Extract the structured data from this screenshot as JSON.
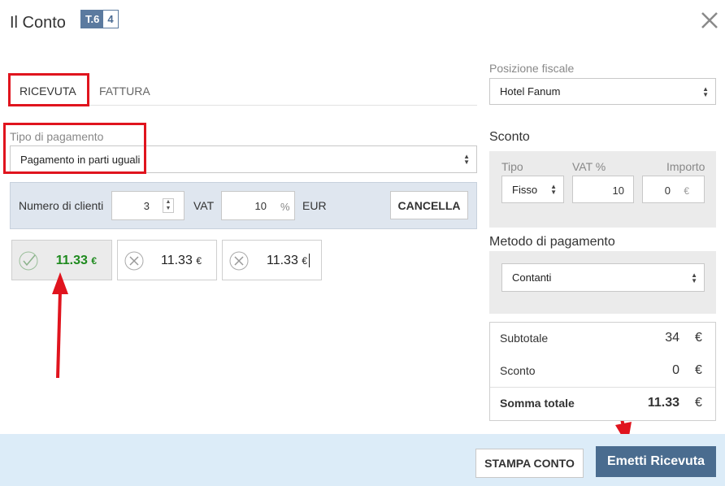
{
  "header": {
    "title": "Il Conto",
    "table_badge": "T.6",
    "guests_badge": "4"
  },
  "tabs": [
    {
      "label": "RICEVUTA",
      "active": true
    },
    {
      "label": "FATTURA",
      "active": false
    }
  ],
  "payment_type": {
    "label": "Tipo di pagamento",
    "value": "Pagamento in parti uguali"
  },
  "split": {
    "clients_label": "Numero di clienti",
    "clients_value": "3",
    "vat_label": "VAT",
    "vat_value": "10",
    "vat_unit": "%",
    "currency_label": "EUR",
    "cancel_label": "CANCELLA"
  },
  "shares": [
    {
      "amount": "11.33",
      "currency": "€",
      "paid": true
    },
    {
      "amount": "11.33",
      "currency": "€",
      "paid": false
    },
    {
      "amount": "11.33",
      "currency": "€",
      "paid": false
    }
  ],
  "fiscal": {
    "label": "Posizione fiscale",
    "value": "Hotel Fanum"
  },
  "discount": {
    "title": "Sconto",
    "type_label": "Tipo",
    "type_value": "Fisso",
    "vat_label": "VAT %",
    "vat_value": "10",
    "amount_label": "Importo",
    "amount_value": "0",
    "amount_unit": "€"
  },
  "payment_method": {
    "title": "Metodo di pagamento",
    "value": "Contanti"
  },
  "totals": {
    "subtotal_label": "Subtotale",
    "subtotal_value": "34",
    "discount_label": "Sconto",
    "discount_value": "0",
    "total_label": "Somma totale",
    "total_value": "11.33",
    "currency": "€"
  },
  "footer": {
    "print_label": "STAMPA CONTO",
    "issue_label": "Emetti Ricevuta"
  },
  "colors": {
    "accent": "#4a6c8f",
    "annotation_red": "#e0141e",
    "paid_green": "#1e8a1e",
    "footer_bg": "#dcecf8"
  }
}
